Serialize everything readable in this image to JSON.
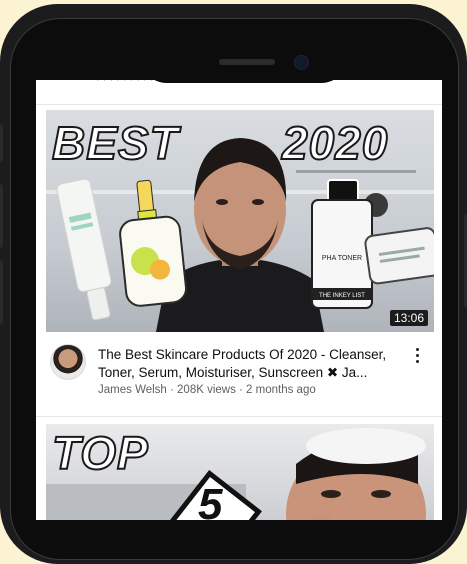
{
  "feed": {
    "top_cut_text": "· · · · · · · · · · · · · · · · · · ·",
    "video1": {
      "thumb_text_left": "BEST",
      "thumb_text_right": "2020",
      "duration": "13:06",
      "title_line1": "The Best Skincare Products Of 2020 - Cleanser,",
      "title_line2": "Toner, Serum, Moisturiser, Sunscreen ✖ Ja...",
      "channel_views_age": "James Welsh · 208K views · 2 months ago",
      "bottle_label": "PHA TONER",
      "bottle_brand": "THE INKEY LIST"
    },
    "video2": {
      "thumb_text": "TOP",
      "thumb_number": "5"
    }
  },
  "colors": {
    "background": "#fbf3d1",
    "phone": "#1c1c1e",
    "title_text": "#0f0f0f",
    "meta_text": "#606060"
  }
}
